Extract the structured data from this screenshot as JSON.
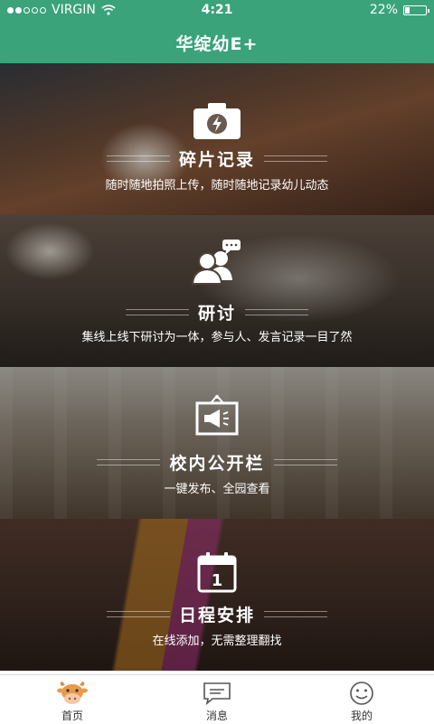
{
  "status_bar": {
    "carrier": "VIRGIN",
    "time": "4:21",
    "battery_percent": "22%",
    "battery_level": 0.22
  },
  "navbar": {
    "title": "华绽幼E+"
  },
  "panels": [
    {
      "title": "碎片记录",
      "subtitle": "随时随地拍照上传，随时随地记录幼儿动态",
      "icon": "camera-icon"
    },
    {
      "title": "研讨",
      "subtitle": "集线上线下研讨为一体，参与人、发言记录一目了然",
      "icon": "discussion-icon"
    },
    {
      "title": "校内公开栏",
      "subtitle": "一键发布、全园查看",
      "icon": "announcement-board-icon"
    },
    {
      "title": "日程安排",
      "subtitle": "在线添加，无需整理翻找",
      "icon": "calendar-icon",
      "calendar_day": "1"
    }
  ],
  "tabbar": {
    "items": [
      {
        "label": "首页",
        "icon": "cow-mascot-icon",
        "active": true
      },
      {
        "label": "消息",
        "icon": "message-icon",
        "active": false
      },
      {
        "label": "我的",
        "icon": "smiley-icon",
        "active": false
      }
    ]
  }
}
